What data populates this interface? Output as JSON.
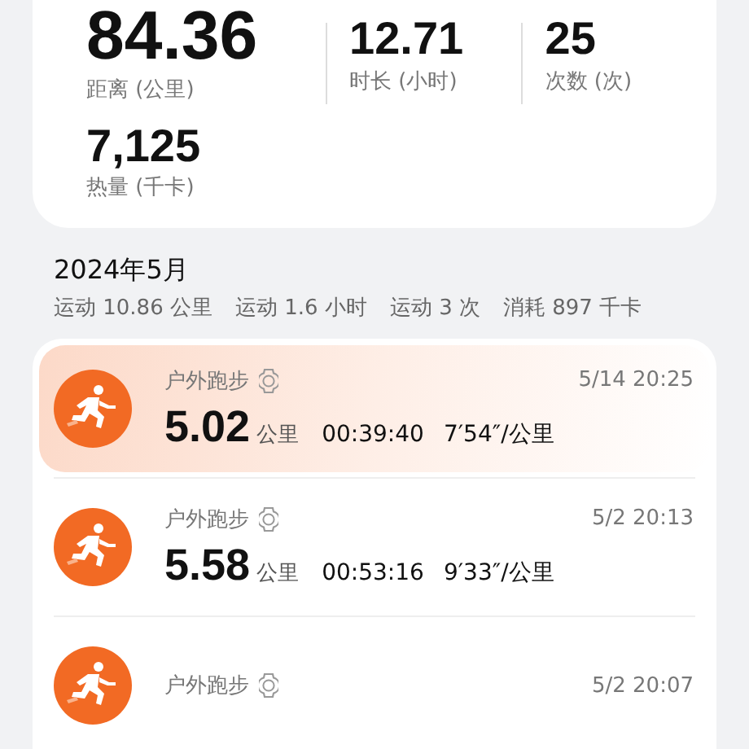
{
  "summary": {
    "stats": [
      {
        "value": "84.36",
        "label": "距离 (公里)",
        "kind": "main"
      },
      {
        "value": "12.71",
        "label": "时长 (小时)",
        "kind": "minor"
      },
      {
        "value": "25",
        "label": "次数 (次)",
        "kind": "minor"
      },
      {
        "value": "7,125",
        "label": "热量 (千卡)",
        "kind": "wide"
      }
    ]
  },
  "month": {
    "title": "2024年5月",
    "totals": [
      "运动 10.86 公里",
      "运动 1.6 小时",
      "运动 3 次",
      "消耗 897 千卡"
    ]
  },
  "records": [
    {
      "type": "户外跑步",
      "time": "5/14 20:25",
      "distance": "5.02",
      "unit": "公里",
      "duration": "00:39:40",
      "pace": "7′54″/公里",
      "selected": true
    },
    {
      "type": "户外跑步",
      "time": "5/2 20:13",
      "distance": "5.58",
      "unit": "公里",
      "duration": "00:53:16",
      "pace": "9′33″/公里",
      "selected": false
    },
    {
      "type": "户外跑步",
      "time": "5/2 20:07",
      "selected": false
    }
  ]
}
